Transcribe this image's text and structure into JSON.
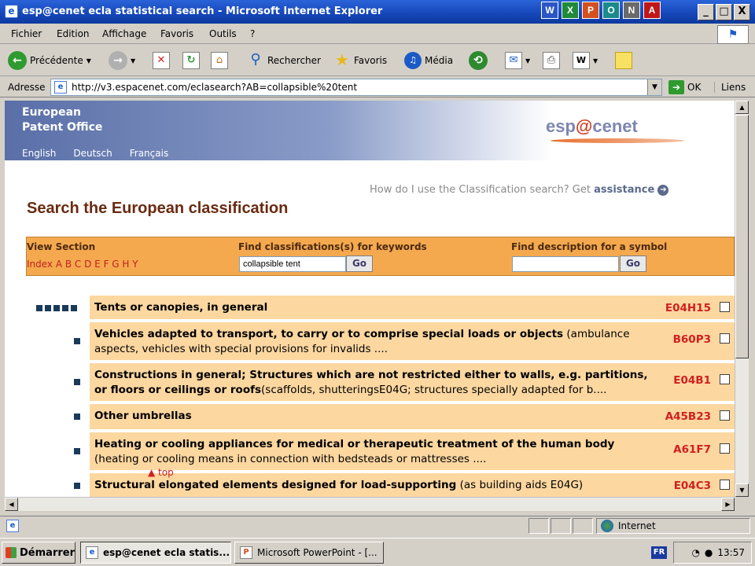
{
  "window": {
    "title": "esp@cenet ecla statistical search - Microsoft Internet Explorer",
    "app_icon": "ie-page-icon",
    "controls": [
      "_",
      "□",
      "X"
    ]
  },
  "titlebar_apps": [
    {
      "icon": "word-icon",
      "glyph": "W",
      "color": "#2a56c6"
    },
    {
      "icon": "excel-icon",
      "glyph": "X",
      "color": "#1f8a3a"
    },
    {
      "icon": "powerpoint-icon",
      "glyph": "P",
      "color": "#d2511f"
    },
    {
      "icon": "outlook-icon",
      "glyph": "O",
      "color": "#1a8a8a"
    },
    {
      "icon": "notepad-icon",
      "glyph": "N",
      "color": "#6a6a6a"
    },
    {
      "icon": "acrobat-icon",
      "glyph": "A",
      "color": "#c01818"
    }
  ],
  "menu": [
    "Fichier",
    "Edition",
    "Affichage",
    "Favoris",
    "Outils",
    "?"
  ],
  "toolbar": {
    "back": "Précédente",
    "search": "Rechercher",
    "favorites": "Favoris",
    "media": "Média"
  },
  "address": {
    "label": "Adresse",
    "url": "http://v3.espacenet.com/eclasearch?AB=collapsible%20tent",
    "go": "OK",
    "links": "Liens"
  },
  "banner": {
    "org_line1": "European",
    "org_line2": "Patent Office",
    "languages": [
      "English",
      "Deutsch",
      "Français"
    ],
    "logo_pre": "esp",
    "logo_at": "@",
    "logo_post": "cenet"
  },
  "help": {
    "text": "How do I use the Classification search? Get ",
    "link": "assistance"
  },
  "page_title": "Search the European classification",
  "search_panel": {
    "view_section_label": "View Section",
    "index_label": "Index A B C D E F G H Y",
    "keywords_label": "Find classifications(s) for keywords",
    "keywords_value": "collapsible tent",
    "symbol_label": "Find description for a symbol",
    "symbol_value": "",
    "go_label": "Go"
  },
  "results": [
    {
      "bold": "Tents or canopies, in general",
      "rest": "",
      "code": "E04H15",
      "level": 5
    },
    {
      "bold": "Vehicles adapted to transport, to carry or to comprise special loads or objects",
      "rest": " (ambulance aspects, vehicles with special provisions for invalids ....",
      "code": "B60P3",
      "level": 1
    },
    {
      "bold": "Constructions in general; Structures which are not restricted either to walls, e.g. partitions, or floors or ceilings or roofs",
      "rest": "(scaffolds, shutteringsE04G; structures specially adapted for b....",
      "code": "E04B1",
      "level": 1
    },
    {
      "bold": "Other umbrellas",
      "rest": "",
      "code": "A45B23",
      "level": 1
    },
    {
      "bold": "Heating or cooling appliances for medical or therapeutic treatment of the human body",
      "rest": " (heating or cooling means in connection with bedsteads or mattresses ....",
      "code": "A61F7",
      "level": 1
    },
    {
      "bold": "Structural elongated elements designed for load-supporting",
      "rest": " (as building aids E04G)",
      "code": "E04C3",
      "level": 1
    }
  ],
  "top_link": "▲ top",
  "status": {
    "zone": "Internet"
  },
  "taskbar": {
    "start": "Démarrer",
    "tasks": [
      "esp@cenet ecla statis...",
      "Microsoft PowerPoint - [..."
    ],
    "lang": "FR",
    "clock": "13:57"
  }
}
